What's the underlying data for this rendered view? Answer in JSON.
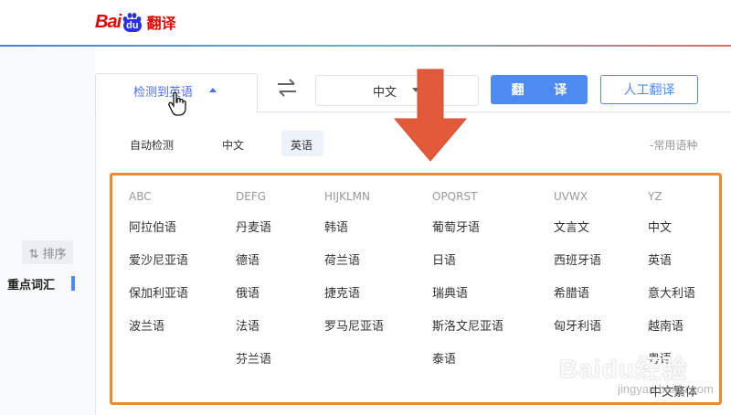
{
  "header": {
    "logo_bai": "Bai",
    "logo_du": "du",
    "logo_fanyi": "翻译"
  },
  "sidebar": {
    "sort_label": "⇅ 排序",
    "vocab_label": "重点词汇"
  },
  "selector": {
    "source_label": "检测到英语",
    "target_label": "中文",
    "translate_button": "翻 译",
    "human_button": "人工翻译"
  },
  "dropdown": {
    "quick_options": [
      "自动检测",
      "中文",
      "英语"
    ],
    "selected_quick": "英语",
    "common_label": "-常用语种",
    "columns": [
      {
        "header": "ABC",
        "languages": [
          "阿拉伯语",
          "爱沙尼亚语",
          "保加利亚语",
          "波兰语"
        ]
      },
      {
        "header": "DEFG",
        "languages": [
          "丹麦语",
          "德语",
          "俄语",
          "法语",
          "芬兰语"
        ]
      },
      {
        "header": "HIJKLMN",
        "languages": [
          "韩语",
          "荷兰语",
          "捷克语",
          "罗马尼亚语"
        ]
      },
      {
        "header": "OPQRST",
        "languages": [
          "葡萄牙语",
          "日语",
          "瑞典语",
          "斯洛文尼亚语",
          "泰语"
        ]
      },
      {
        "header": "UVWX",
        "languages": [
          "文言文",
          "西班牙语",
          "希腊语",
          "匈牙利语"
        ]
      },
      {
        "header": "YZ",
        "languages": [
          "中文",
          "英语",
          "意大利语",
          "越南语",
          "粤语",
          "中文繁体"
        ]
      }
    ]
  },
  "watermark": {
    "logo": "Baidu经验",
    "url": "jingyan.baidu.com"
  },
  "colors": {
    "accent": "#4e8bf1",
    "brand_red": "#e10602",
    "annotation_orange": "#f08a2e",
    "arrow": "#e25a3a"
  }
}
